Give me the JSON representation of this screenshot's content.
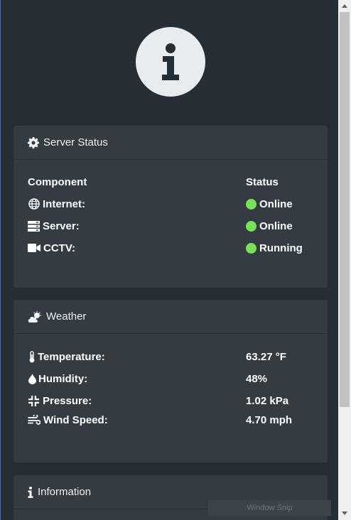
{
  "server_status": {
    "title": "Server Status",
    "col_component": "Component",
    "col_status": "Status",
    "rows": [
      {
        "label": "Internet:",
        "status": "Online",
        "icon": "globe-icon"
      },
      {
        "label": "Server:",
        "status": "Online",
        "icon": "server-icon"
      },
      {
        "label": "CCTV:",
        "status": "Running",
        "icon": "video-camera-icon"
      }
    ],
    "status_color": "#7ae05c"
  },
  "weather": {
    "title": "Weather",
    "rows": [
      {
        "label": "Temperature:",
        "value": "63.27 °F",
        "icon": "thermometer-icon"
      },
      {
        "label": "Humidity:",
        "value": "48%",
        "icon": "droplet-icon"
      },
      {
        "label": "Pressure:",
        "value": "1.02 kPa",
        "icon": "compress-icon"
      },
      {
        "label": "Wind Speed:",
        "value": "4.70 mph",
        "icon": "wind-icon"
      }
    ]
  },
  "information": {
    "title": "Information"
  },
  "overlay": {
    "snip_label": "Window Snip"
  },
  "colors": {
    "background": "#262e35",
    "card": "#343b41",
    "info_circle": "#e8ecef"
  }
}
